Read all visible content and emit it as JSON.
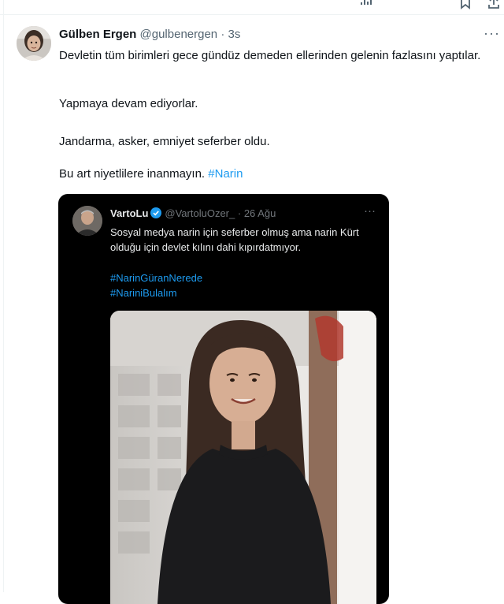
{
  "tweet": {
    "author_name": "Gülben Ergen",
    "handle": "@gulbenergen",
    "separator": "·",
    "time": "3s",
    "lines": [
      "Devletin tüm birimleri gece gündüz demeden ellerinden gelenin fazlasını yaptılar.",
      "Yapmaya devam ediyorlar.",
      "Jandarma, asker, emniyet seferber oldu.",
      "Bu art niyetlilere inanmayın."
    ],
    "hashtag": "#Narin",
    "more_icon": "more-dots-icon"
  },
  "embedded": {
    "author_name": "VartoLu",
    "handle": "@VartoluOzer_",
    "separator": "·",
    "time": "26 Ağu",
    "text": "Sosyal medya narin için seferber olmuş ama narin Kürt olduğu için devlet kılını dahi kıpırdatmıyor.",
    "hashtags": [
      "#NarinGüranNerede",
      "#NariniBulalım"
    ],
    "verified_color": "#1d9bf0",
    "photo": "girl-portrait-photo"
  },
  "colors": {
    "accent": "#1d9bf0",
    "text_primary": "#0f1419",
    "text_secondary": "#536471",
    "embed_background": "#000000"
  }
}
